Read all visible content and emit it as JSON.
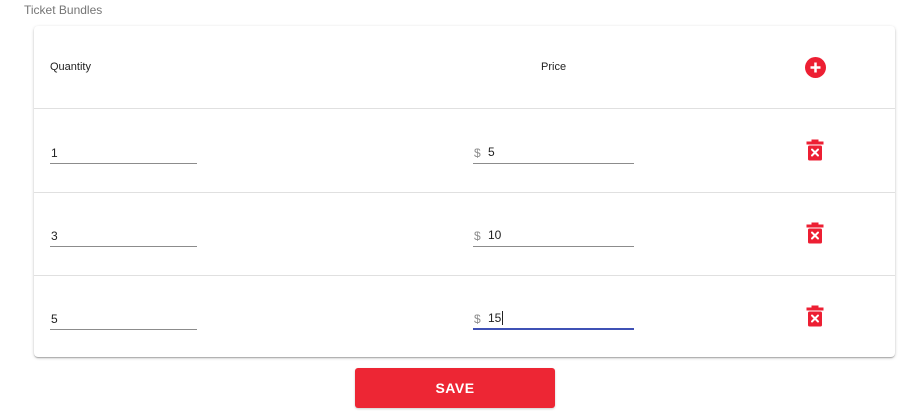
{
  "section": {
    "title": "Ticket Bundles"
  },
  "table": {
    "headers": {
      "quantity": "Quantity",
      "price": "Price"
    },
    "add_icon": "plus-circle-icon",
    "delete_icon": "trash-x-icon",
    "currency_symbol": "$",
    "rows": [
      {
        "quantity": "1",
        "price": "5"
      },
      {
        "quantity": "3",
        "price": "10"
      },
      {
        "quantity": "5",
        "price": "15",
        "focused": true
      }
    ]
  },
  "actions": {
    "save_label": "SAVE"
  },
  "colors": {
    "accent": "#ed1f33",
    "focus_underline": "#3f51b5",
    "divider": "#e0e0e0"
  }
}
